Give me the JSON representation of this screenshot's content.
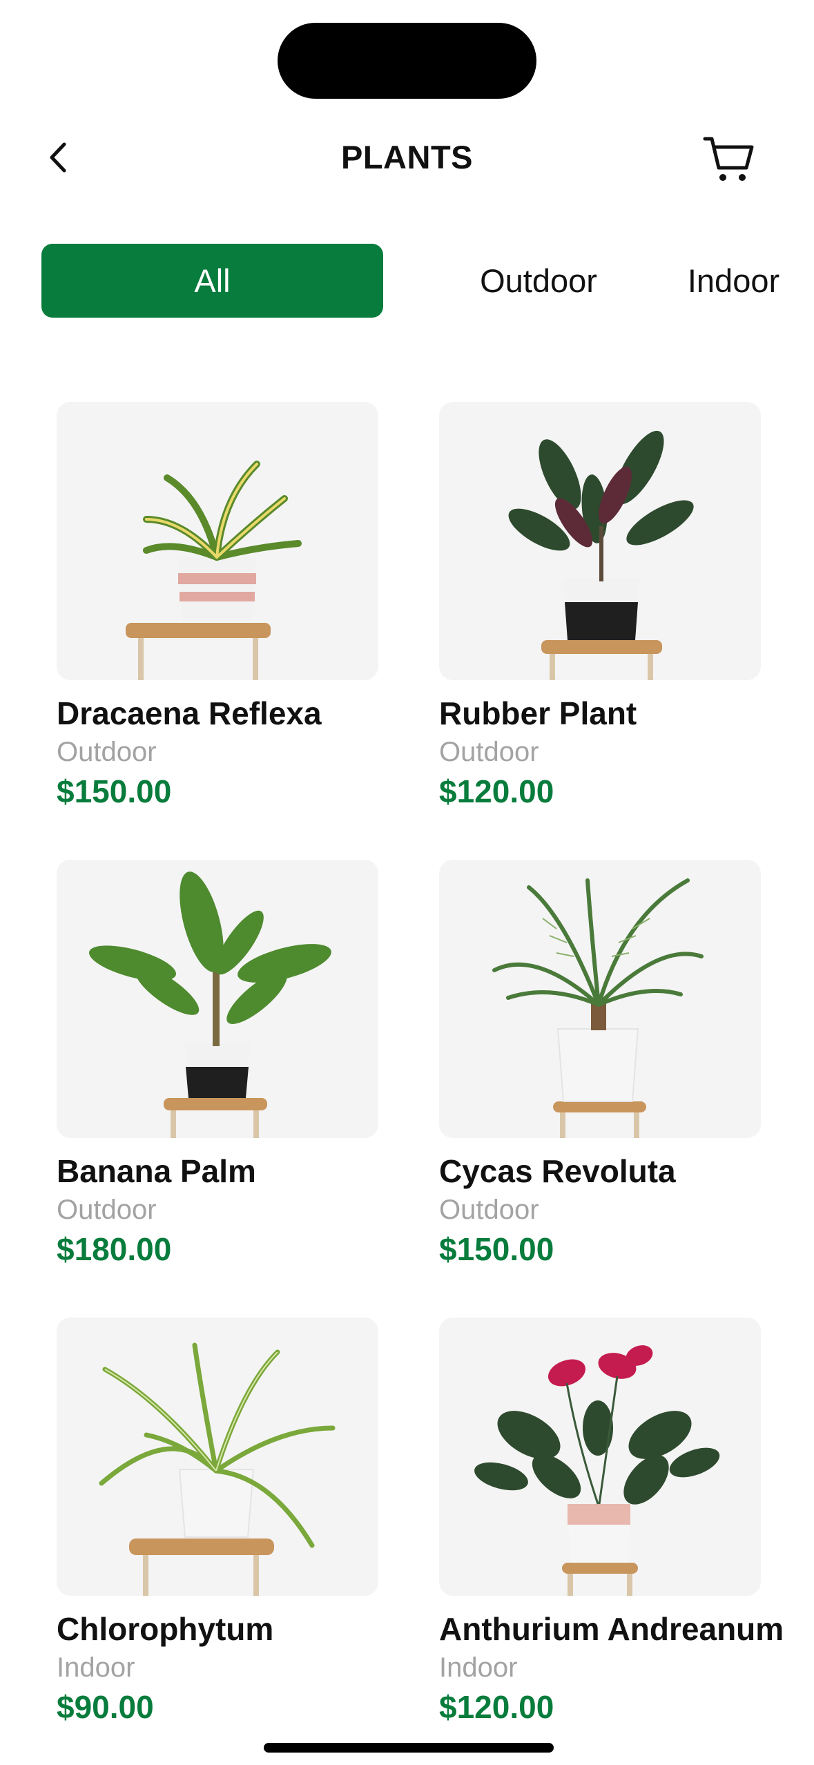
{
  "header": {
    "title": "PLANTS",
    "back_icon": "chevron-left-icon",
    "cart_icon": "cart-icon"
  },
  "tabs": [
    {
      "label": "All",
      "active": true
    },
    {
      "label": "Outdoor",
      "active": false
    },
    {
      "label": "Indoor",
      "active": false
    }
  ],
  "products": [
    {
      "name": "Dracaena Reflexa",
      "category": "Outdoor",
      "price": "$150.00"
    },
    {
      "name": "Rubber Plant",
      "category": "Outdoor",
      "price": "$120.00"
    },
    {
      "name": "Banana Palm",
      "category": "Outdoor",
      "price": "$180.00"
    },
    {
      "name": "Cycas Revoluta",
      "category": "Outdoor",
      "price": "$150.00"
    },
    {
      "name": "Chlorophytum",
      "category": "Indoor",
      "price": "$90.00"
    },
    {
      "name": "Anthurium Andreanum",
      "category": "Indoor",
      "price": "$120.00"
    }
  ],
  "colors": {
    "accent": "#087c3c",
    "muted_text": "#a3a3a3",
    "card_background": "#f4f4f4"
  }
}
